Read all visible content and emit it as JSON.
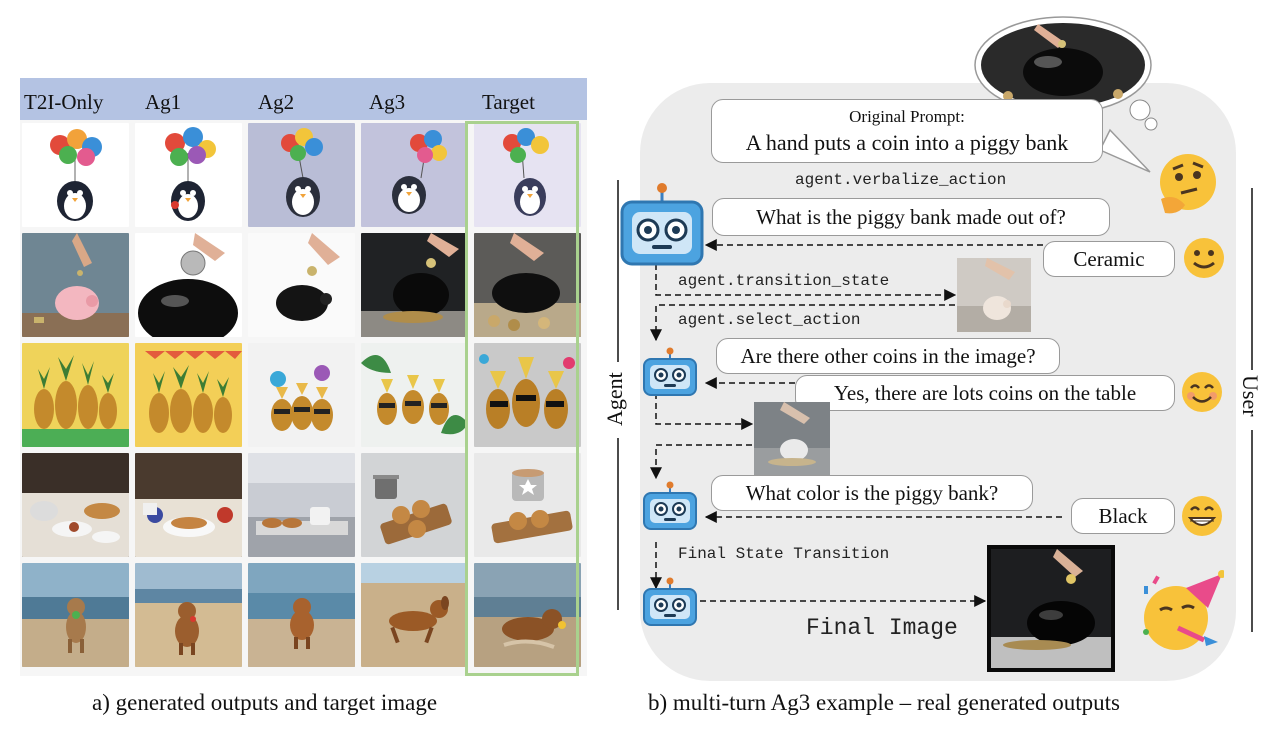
{
  "left_panel": {
    "columns": [
      "T2I-Only",
      "Ag1",
      "Ag2",
      "Ag3",
      "Target"
    ],
    "caption": "a) generated outputs and target image"
  },
  "right_panel": {
    "prompt_label": "Original Prompt:",
    "prompt_text": "A hand puts a coin into a piggy bank",
    "verbalize_action": "agent.verbalize_action",
    "questions": [
      "What is the piggy bank made out of?",
      "Are there other coins in the image?",
      "What color is the piggy bank?"
    ],
    "answers": [
      "Ceramic",
      "Yes, there are lots coins on the table",
      "Black"
    ],
    "transition_state": "agent.transition_state",
    "select_action": "agent.select_action",
    "final_state_transition": "Final State Transition",
    "final_image_label": "Final Image",
    "agent_label": "Agent",
    "user_label": "User",
    "caption": "b) multi-turn Ag3 example – real generated outputs"
  }
}
